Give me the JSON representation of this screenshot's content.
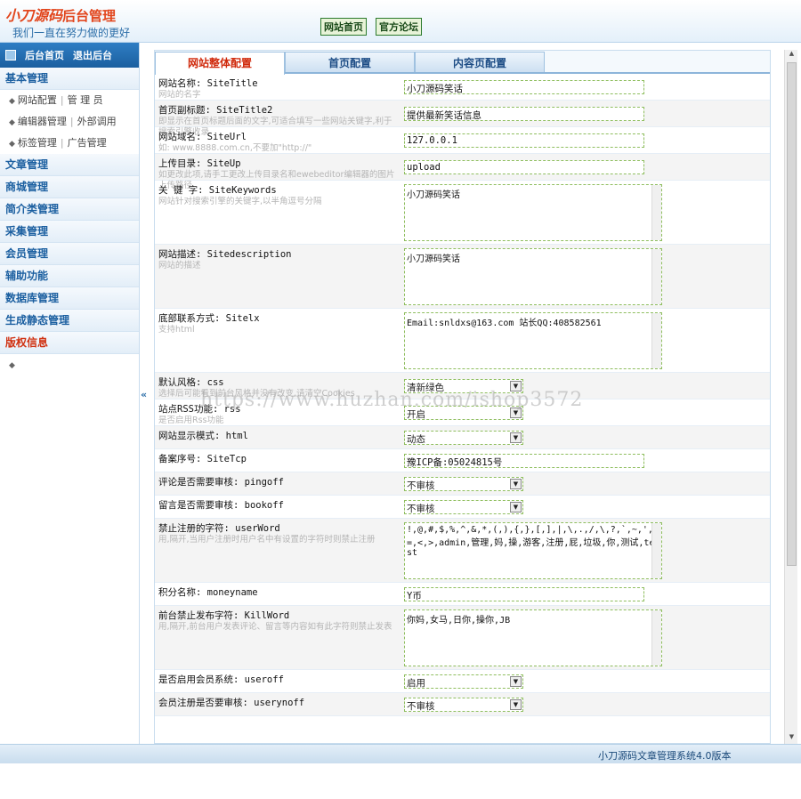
{
  "header": {
    "brand": "小刀源码",
    "suffix": "后台管理",
    "slogan": "我们一直在努力做的更好",
    "links": [
      "网站首页",
      "官方论坛"
    ]
  },
  "sidebar": {
    "top": [
      "后台首页",
      "退出后台"
    ],
    "groups": [
      {
        "title": "基本管理",
        "items": [
          [
            "网站配置",
            "管 理 员"
          ],
          [
            "编辑器管理",
            "外部调用"
          ],
          [
            "标签管理",
            "广告管理"
          ]
        ]
      },
      {
        "title": "文章管理"
      },
      {
        "title": "商城管理"
      },
      {
        "title": "简介类管理"
      },
      {
        "title": "采集管理"
      },
      {
        "title": "会员管理"
      },
      {
        "title": "辅助功能"
      },
      {
        "title": "数据库管理"
      },
      {
        "title": "生成静态管理"
      },
      {
        "title": "版权信息"
      }
    ],
    "collapse": "«"
  },
  "tabs": [
    "网站整体配置",
    "首页配置",
    "内容页配置"
  ],
  "form": [
    {
      "label": "网站名称: SiteTitle",
      "hint": "网站的名字",
      "type": "input",
      "value": "小刀源码笑话",
      "width": 270
    },
    {
      "label": "首页副标题: SiteTitle2",
      "hint": "即显示在首页标题后面的文字,可适合填写一些网站关键字,利于搜索引擎收录",
      "type": "input",
      "value": "提供最新笑话信息",
      "width": 270
    },
    {
      "label": "网站域名: SiteUrl",
      "hint": "如: www.8888.com.cn,不要加\"http://\"",
      "type": "input",
      "value": "127.0.0.1",
      "width": 270
    },
    {
      "label": "上传目录: SiteUp",
      "hint": "如更改此项,请手工更改上传目录名和ewebeditor编辑器的图片上传路径",
      "type": "input",
      "value": "upload",
      "width": 270
    },
    {
      "label": "关 键 字: SiteKeywords",
      "hint": "网站针对搜索引擎的关键字,以半角逗号分隔",
      "type": "textarea",
      "value": "小刀源码笑话"
    },
    {
      "label": "网站描述: Sitedescription",
      "hint": "网站的描述",
      "type": "textarea",
      "value": "小刀源码笑话"
    },
    {
      "label": "底部联系方式: Sitelx",
      "hint": "支持html",
      "type": "textarea",
      "value": "Email:snldxs@163.com 站长QQ:408582561"
    },
    {
      "label": "默认风格: css",
      "hint": "选择后可能看到前台风格并没有改变,请清空Cookies",
      "type": "select",
      "value": "清新绿色"
    },
    {
      "label": "站点RSS功能: rss",
      "hint": "是否启用Rss功能",
      "type": "select",
      "value": "开启"
    },
    {
      "label": "网站显示模式: html",
      "hint": "",
      "type": "select",
      "value": "动态"
    },
    {
      "label": "备案序号: SiteTcp",
      "hint": "",
      "type": "input",
      "value": "豫ICP备:05024815号",
      "width": 270
    },
    {
      "label": "评论是否需要审核: pingoff",
      "hint": "",
      "type": "select",
      "value": "不审核"
    },
    {
      "label": "留言是否需要审核: bookoff",
      "hint": "",
      "type": "select",
      "value": "不审核"
    },
    {
      "label": "禁止注册的字符: userWord",
      "hint": "用,隔开,当用户注册时用户名中有设置的字符时则禁止注册",
      "type": "textarea",
      "value": "!,@,#,$,%,^,&,*,(,),{,},[,],|,\\,.,/,\\,?,`,~,',=,<,>,admin,管理,妈,操,游客,注册,屁,垃圾,你,测试,test"
    },
    {
      "label": "积分名称: moneyname",
      "hint": "",
      "type": "input",
      "value": "Y币",
      "width": 270
    },
    {
      "label": "前台禁止发布字符: KillWord",
      "hint": "用,隔开,前台用户发表评论、留言等内容如有此字符则禁止发表",
      "type": "textarea",
      "value": "你妈,女马,日你,操你,JB"
    },
    {
      "label": "是否启用会员系统: useroff",
      "hint": "",
      "type": "select",
      "value": "启用"
    },
    {
      "label": "会员注册是否要审核: userynoff",
      "hint": "",
      "type": "select",
      "value": "不审核"
    }
  ],
  "watermark": "https://www.huzhan.com/ishop3572",
  "footer": "小刀源码文章管理系统4.0版本",
  "icons": {
    "menu": "grid-icon",
    "bullet": "diamond-bullet-icon"
  },
  "colors": {
    "brand": "#e2461d",
    "nav": "#1b5fa0",
    "tabActive": "#d02a0c",
    "inputBorder": "#8fbe5f"
  }
}
